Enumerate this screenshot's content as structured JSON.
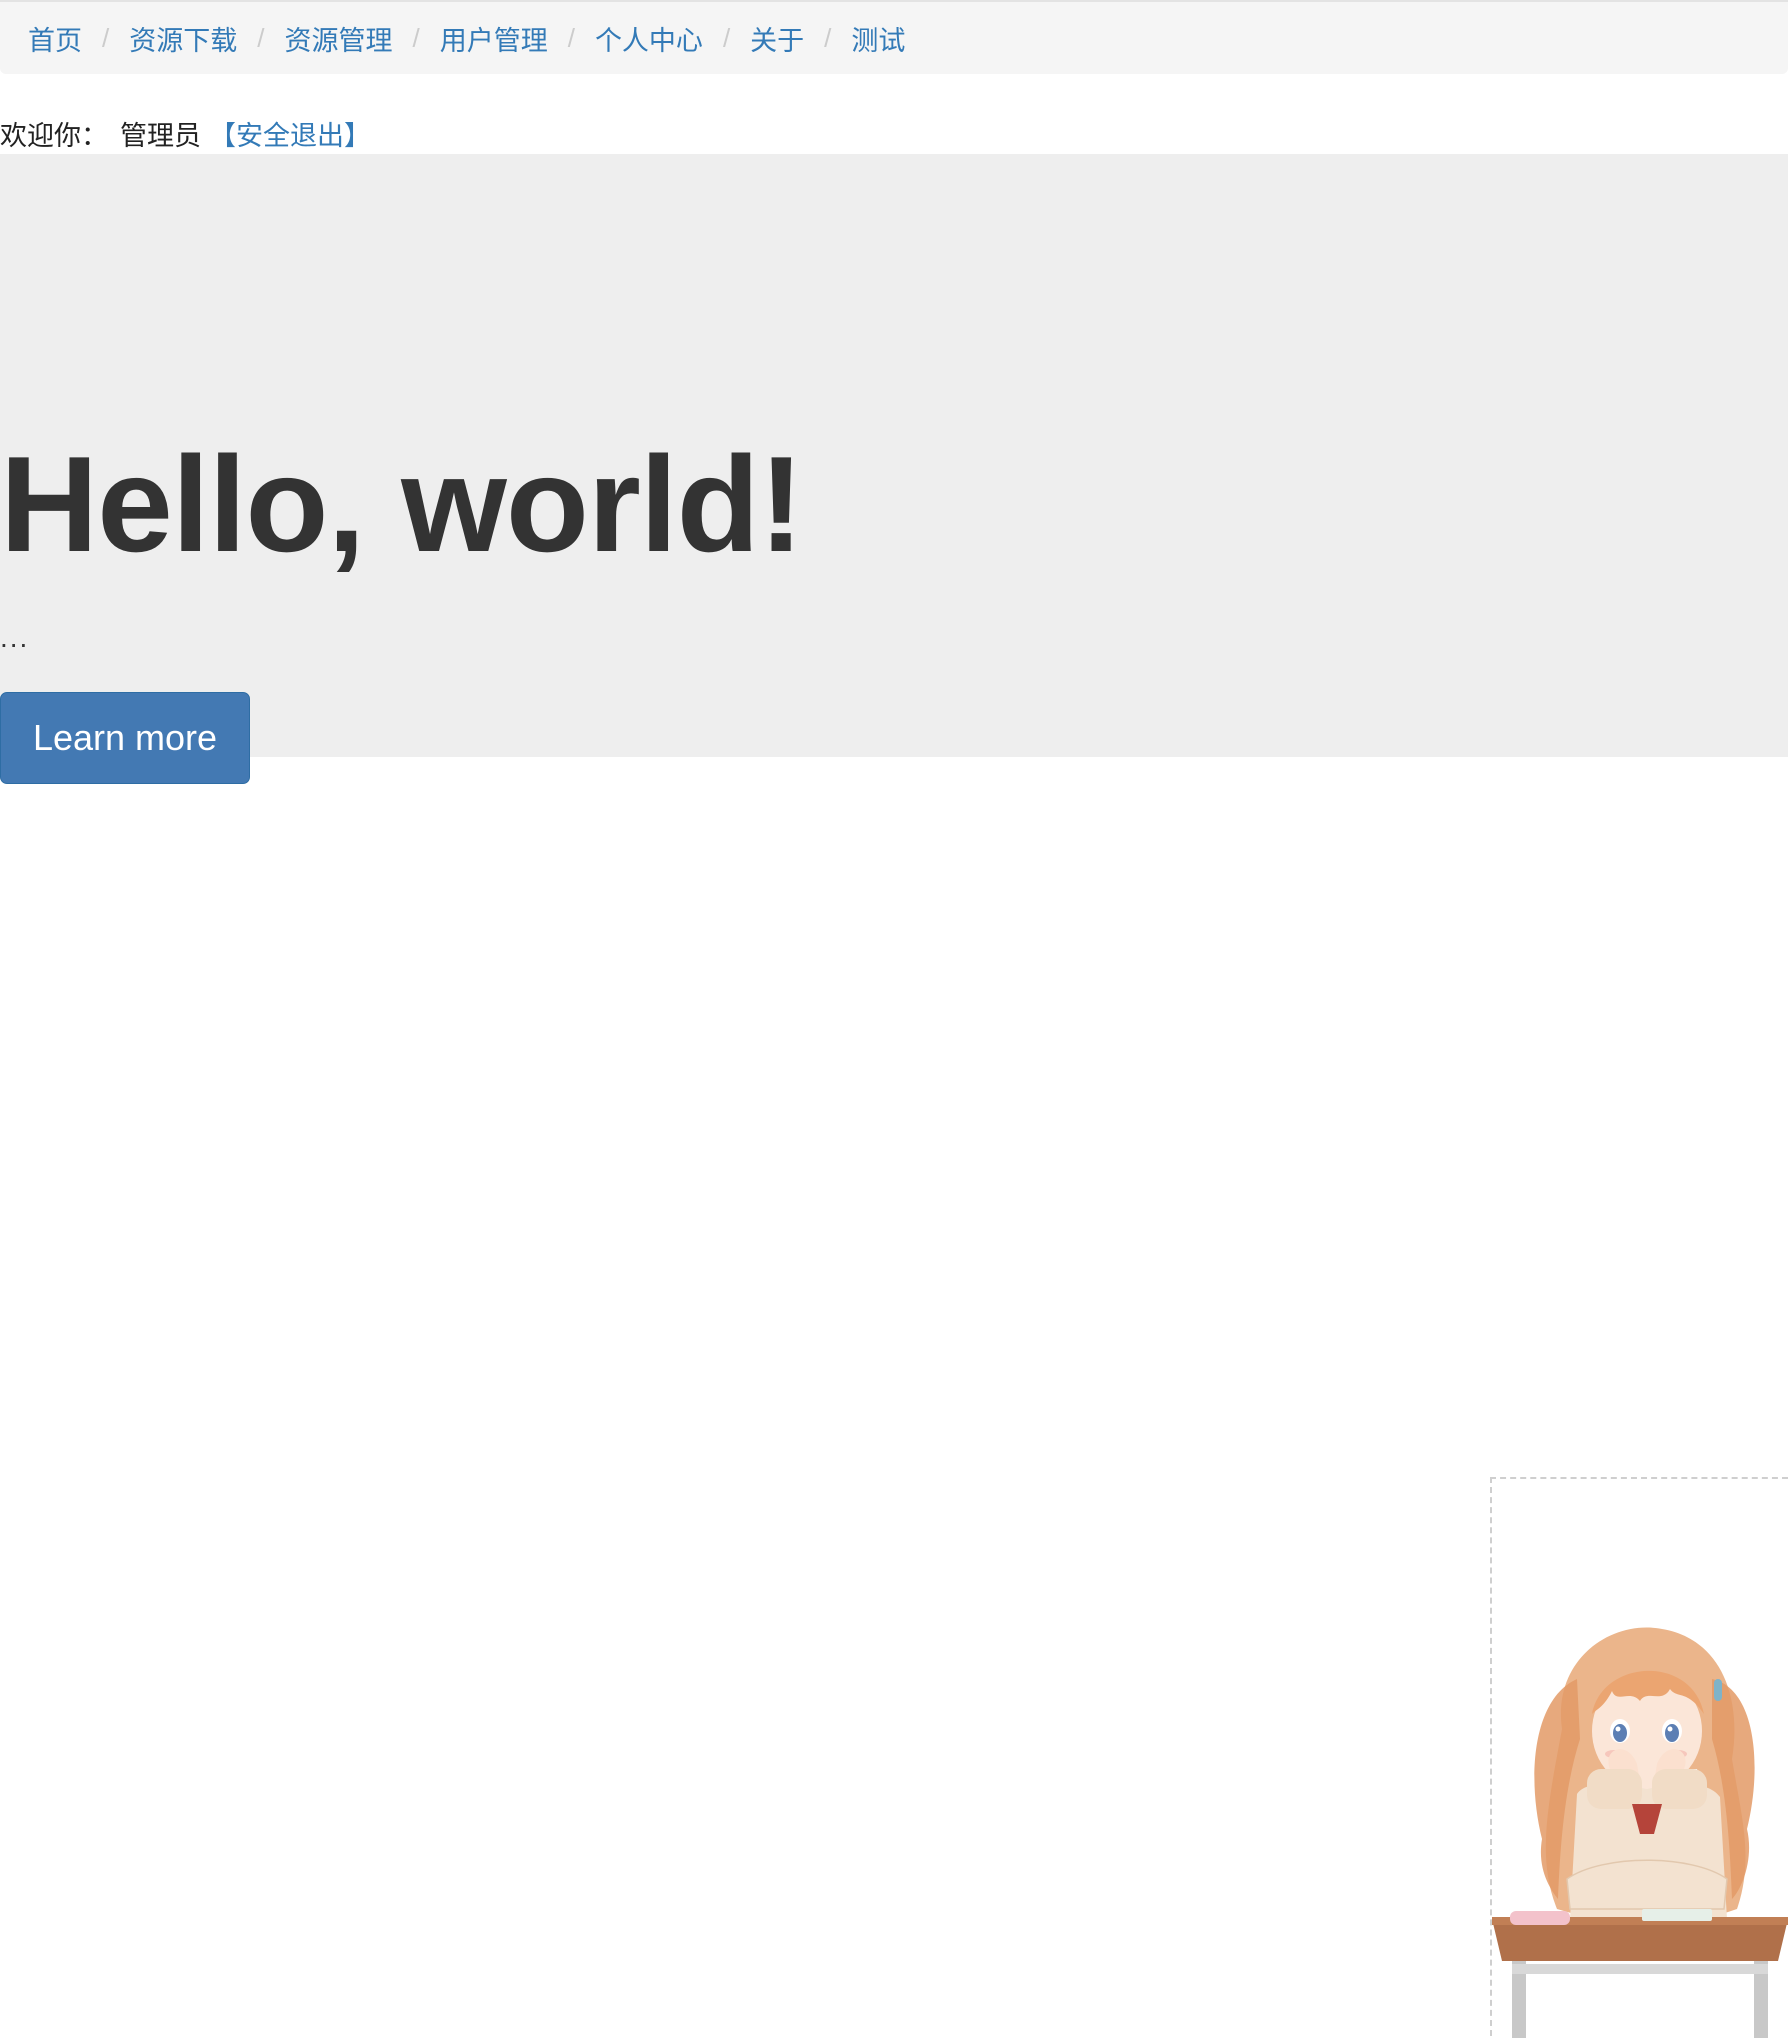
{
  "breadcrumb": {
    "items": [
      {
        "label": "首页"
      },
      {
        "label": "资源下载"
      },
      {
        "label": "资源管理"
      },
      {
        "label": "用户管理"
      },
      {
        "label": "个人中心"
      },
      {
        "label": "关于"
      },
      {
        "label": "测试"
      }
    ],
    "separator": "/"
  },
  "welcome": {
    "prefix": "欢迎你：",
    "username": "管理员",
    "logout_label": "【安全退出】"
  },
  "jumbotron": {
    "title": "Hello, world!",
    "lead": "...",
    "button_label": "Learn more"
  },
  "mascot": {
    "icon": "anime-girl-at-desk-illustration"
  },
  "colors": {
    "link": "#337ab7",
    "primary_button": "#4379b3",
    "jumbotron_bg": "#eeeeee",
    "breadcrumb_bg": "#f5f5f5"
  }
}
